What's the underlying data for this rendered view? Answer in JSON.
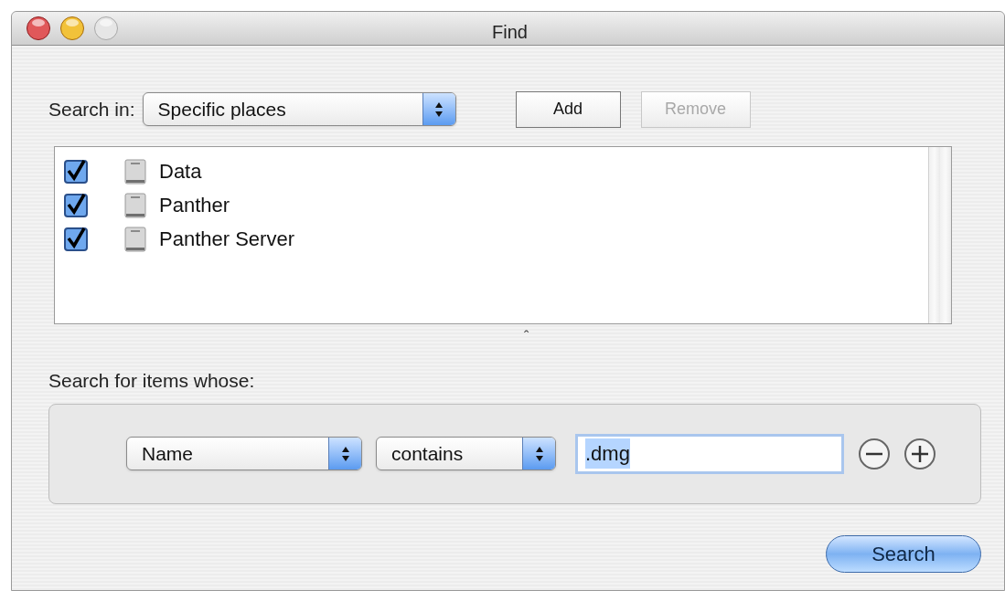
{
  "window": {
    "title": "Find",
    "buttons": [
      {
        "kind": "close",
        "disabled": false
      },
      {
        "kind": "minimize",
        "disabled": false
      },
      {
        "kind": "zoom",
        "disabled": true
      }
    ]
  },
  "search_in": {
    "label": "Search in:",
    "value": "Specific places"
  },
  "place_buttons": [
    {
      "label": "Add",
      "disabled": false
    },
    {
      "label": "Remove",
      "disabled": true
    }
  ],
  "places": [
    {
      "name": "Data",
      "checked": true
    },
    {
      "name": "Panther",
      "checked": true
    },
    {
      "name": "Panther Server",
      "checked": true
    }
  ],
  "splitter": {
    "handle": "ˆ"
  },
  "criteria_label": "Search for items whose:",
  "criteria": [
    {
      "attribute": "Name",
      "operator": "contains",
      "value": ".dmg",
      "text_selected": true
    }
  ],
  "search_button": {
    "label": "Search"
  }
}
